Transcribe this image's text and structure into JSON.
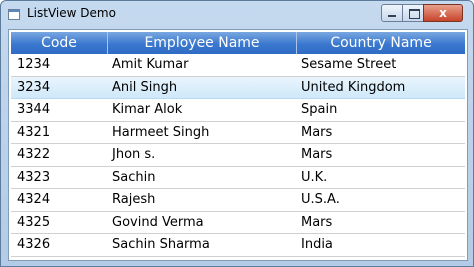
{
  "window": {
    "title": "ListView Demo",
    "close_glyph": "x"
  },
  "icons": [
    "app-window-icon",
    "minimize-icon",
    "maximize-icon",
    "close-icon"
  ],
  "colors": {
    "header_top": "#7aa7e0",
    "header_bottom": "#2f6bc4",
    "selection": "#cfe8f9",
    "close_button": "#c7442a"
  },
  "table": {
    "columns": [
      "Code",
      "Employee Name",
      "Country Name"
    ],
    "rows": [
      {
        "code": "1234",
        "name": "Amit Kumar",
        "country": "Sesame Street"
      },
      {
        "code": "3234",
        "name": "Anil Singh",
        "country": "United Kingdom"
      },
      {
        "code": "3344",
        "name": "Kimar Alok",
        "country": "Spain"
      },
      {
        "code": "4321",
        "name": "Harmeet Singh",
        "country": "Mars"
      },
      {
        "code": "4322",
        "name": "Jhon s.",
        "country": "Mars"
      },
      {
        "code": "4323",
        "name": "Sachin",
        "country": "U.K."
      },
      {
        "code": "4324",
        "name": "Rajesh",
        "country": "U.S.A."
      },
      {
        "code": "4325",
        "name": "Govind Verma",
        "country": "Mars"
      },
      {
        "code": "4326",
        "name": "Sachin Sharma",
        "country": "India"
      }
    ],
    "selected_index": 1
  }
}
